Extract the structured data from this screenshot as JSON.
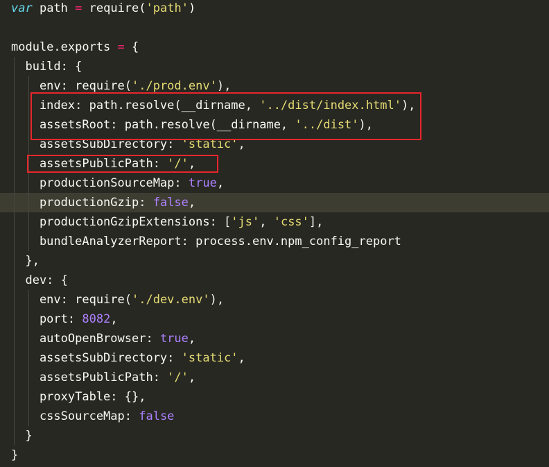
{
  "accent_colors": {
    "background": "#272822",
    "current_line": "#3e3d32",
    "highlight_box": "#e8262c",
    "keyword": "#66d9ef",
    "operator": "#f92672",
    "string": "#e6db74",
    "number": "#ae81ff"
  },
  "code": {
    "lines": [
      [
        [
          "kw",
          "var"
        ],
        [
          "pl",
          " path "
        ],
        [
          "op",
          "="
        ],
        [
          "pl",
          " require("
        ],
        [
          "str",
          "'path'"
        ],
        [
          "pl",
          ")"
        ]
      ],
      [],
      [
        [
          "pl",
          "module.exports "
        ],
        [
          "op",
          "="
        ],
        [
          "pl",
          " {"
        ]
      ],
      [
        [
          "pl",
          "  build: {"
        ]
      ],
      [
        [
          "pl",
          "    env: require("
        ],
        [
          "str",
          "'./prod.env'"
        ],
        [
          "pl",
          "),"
        ]
      ],
      [
        [
          "pl",
          "    index: path.resolve(__dirname, "
        ],
        [
          "str",
          "'../dist/index.html'"
        ],
        [
          "pl",
          "),"
        ]
      ],
      [
        [
          "pl",
          "    assetsRoot: path.resolve(__dirname, "
        ],
        [
          "str",
          "'../dist'"
        ],
        [
          "pl",
          "),"
        ]
      ],
      [
        [
          "pl",
          "    assetsSubDirectory: "
        ],
        [
          "str",
          "'static'"
        ],
        [
          "pl",
          ","
        ]
      ],
      [
        [
          "pl",
          "    assetsPublicPath: "
        ],
        [
          "str",
          "'/'"
        ],
        [
          "pl",
          ","
        ]
      ],
      [
        [
          "pl",
          "    productionSourceMap: "
        ],
        [
          "bool",
          "true"
        ],
        [
          "pl",
          ","
        ]
      ],
      [
        [
          "pl",
          "    productionGzip: "
        ],
        [
          "bool",
          "false"
        ],
        [
          "pl",
          ","
        ]
      ],
      [
        [
          "pl",
          "    productionGzipExtensions: ["
        ],
        [
          "str",
          "'js'"
        ],
        [
          "pl",
          ", "
        ],
        [
          "str",
          "'css'"
        ],
        [
          "pl",
          "],"
        ]
      ],
      [
        [
          "pl",
          "    bundleAnalyzerReport: process.env.npm_config_report"
        ]
      ],
      [
        [
          "pl",
          "  },"
        ]
      ],
      [
        [
          "pl",
          "  dev: {"
        ]
      ],
      [
        [
          "pl",
          "    env: require("
        ],
        [
          "str",
          "'./dev.env'"
        ],
        [
          "pl",
          "),"
        ]
      ],
      [
        [
          "pl",
          "    port: "
        ],
        [
          "num",
          "8082"
        ],
        [
          "pl",
          ","
        ]
      ],
      [
        [
          "pl",
          "    autoOpenBrowser: "
        ],
        [
          "bool",
          "true"
        ],
        [
          "pl",
          ","
        ]
      ],
      [
        [
          "pl",
          "    assetsSubDirectory: "
        ],
        [
          "str",
          "'static'"
        ],
        [
          "pl",
          ","
        ]
      ],
      [
        [
          "pl",
          "    assetsPublicPath: "
        ],
        [
          "str",
          "'/'"
        ],
        [
          "pl",
          ","
        ]
      ],
      [
        [
          "pl",
          "    proxyTable: {},"
        ]
      ],
      [
        [
          "pl",
          "    cssSourceMap: "
        ],
        [
          "bool",
          "false"
        ]
      ],
      [
        [
          "pl",
          "  }"
        ]
      ],
      [
        [
          "pl",
          "}"
        ]
      ]
    ]
  }
}
